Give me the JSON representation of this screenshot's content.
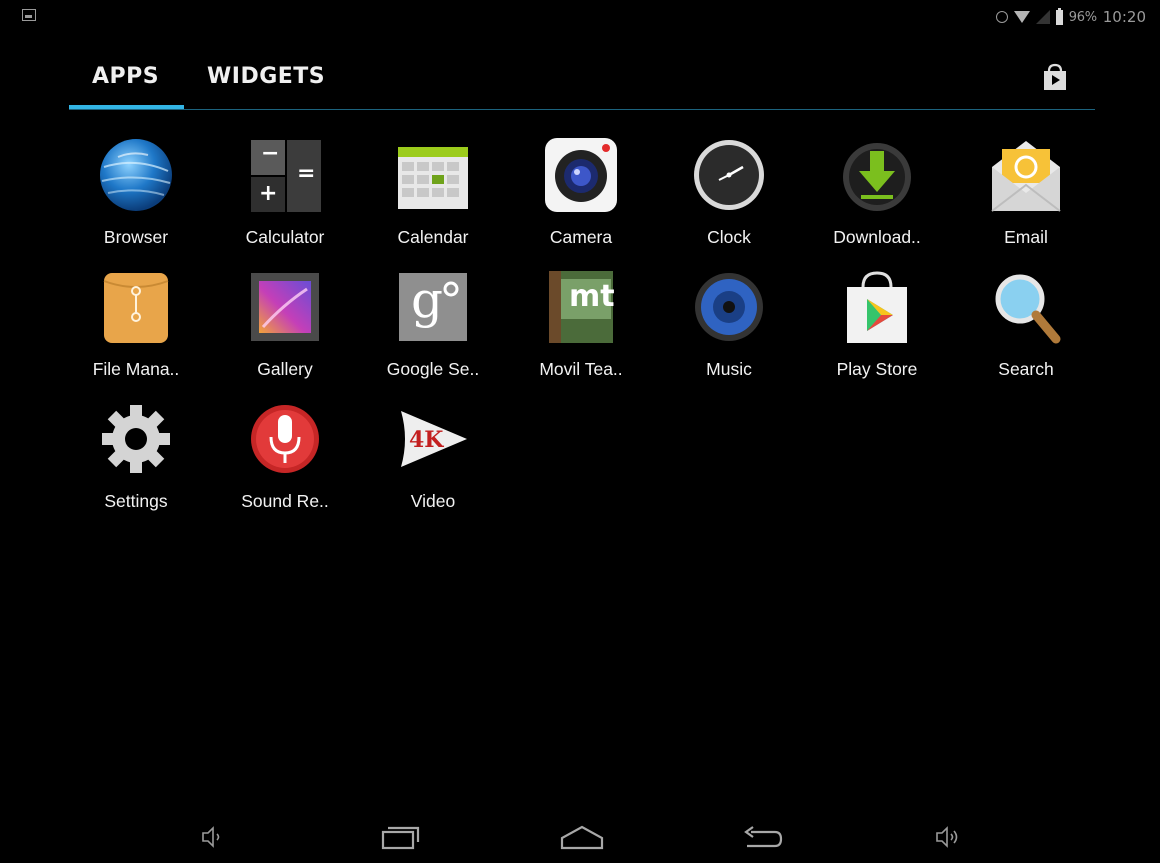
{
  "status_bar": {
    "battery": "96%",
    "time": "10:20",
    "icons": [
      "notification-icon",
      "alarm-icon",
      "wifi-icon",
      "signal-icon",
      "battery-icon"
    ]
  },
  "tabs": [
    {
      "label": "APPS",
      "selected": true
    },
    {
      "label": "WIDGETS",
      "selected": false
    }
  ],
  "accent_color": "#33b5e5",
  "apps": [
    {
      "label": "Browser",
      "icon": "browser-globe-icon"
    },
    {
      "label": "Calculator",
      "icon": "calculator-icon"
    },
    {
      "label": "Calendar",
      "icon": "calendar-icon"
    },
    {
      "label": "Camera",
      "icon": "camera-icon"
    },
    {
      "label": "Clock",
      "icon": "clock-icon"
    },
    {
      "label": "Download..",
      "icon": "download-icon"
    },
    {
      "label": "Email",
      "icon": "email-icon"
    },
    {
      "label": "File Mana..",
      "icon": "file-manager-icon"
    },
    {
      "label": "Gallery",
      "icon": "gallery-icon"
    },
    {
      "label": "Google Se..",
      "icon": "google-settings-icon"
    },
    {
      "label": "Movil Tea..",
      "icon": "movil-tea-icon"
    },
    {
      "label": "Music",
      "icon": "music-icon"
    },
    {
      "label": "Play Store",
      "icon": "play-store-icon"
    },
    {
      "label": "Search",
      "icon": "search-icon"
    },
    {
      "label": "Settings",
      "icon": "settings-gear-icon"
    },
    {
      "label": "Sound Re..",
      "icon": "sound-recorder-icon"
    },
    {
      "label": "Video",
      "icon": "video-4k-icon"
    }
  ],
  "calc_glyphs": {
    "minus": "−",
    "plus": "+",
    "equals": "="
  },
  "google_glyph": "g",
  "movil_glyph": "mt",
  "video_glyph": "4K",
  "navigation": [
    "volume-down-icon",
    "recent-apps-icon",
    "home-icon",
    "back-icon",
    "volume-up-icon"
  ]
}
